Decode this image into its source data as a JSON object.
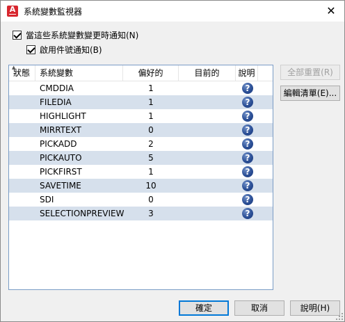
{
  "window": {
    "title": "系統變數監視器",
    "close_glyph": "✕",
    "app_icon_letter": "A"
  },
  "options": {
    "notify_checkbox": {
      "label": "當這些系統變數變更時通知(N)",
      "checked": true
    },
    "balloon_checkbox": {
      "label": "啟用件號通知(B)",
      "checked": true
    }
  },
  "table": {
    "columns": [
      "狀態",
      "系統變數",
      "偏好的",
      "目前的",
      "說明"
    ],
    "rows": [
      {
        "name": "CMDDIA",
        "preferred": "1",
        "current": ""
      },
      {
        "name": "FILEDIA",
        "preferred": "1",
        "current": ""
      },
      {
        "name": "HIGHLIGHT",
        "preferred": "1",
        "current": ""
      },
      {
        "name": "MIRRTEXT",
        "preferred": "0",
        "current": ""
      },
      {
        "name": "PICKADD",
        "preferred": "2",
        "current": ""
      },
      {
        "name": "PICKAUTO",
        "preferred": "5",
        "current": ""
      },
      {
        "name": "PICKFIRST",
        "preferred": "1",
        "current": ""
      },
      {
        "name": "SAVETIME",
        "preferred": "10",
        "current": ""
      },
      {
        "name": "SDI",
        "preferred": "0",
        "current": ""
      },
      {
        "name": "SELECTIONPREVIEW",
        "preferred": "3",
        "current": ""
      }
    ],
    "help_glyph": "?"
  },
  "side_buttons": {
    "reset_all": "全部重置(R)",
    "edit_list": "編輯清單(E)..."
  },
  "footer_buttons": {
    "ok": "確定",
    "cancel": "取消",
    "help": "說明(H)"
  },
  "colors": {
    "alt_row": "#d6e0ec",
    "help_icon": "#2b4f96",
    "app_icon": "#d8262e",
    "focus_border": "#0078d7"
  }
}
